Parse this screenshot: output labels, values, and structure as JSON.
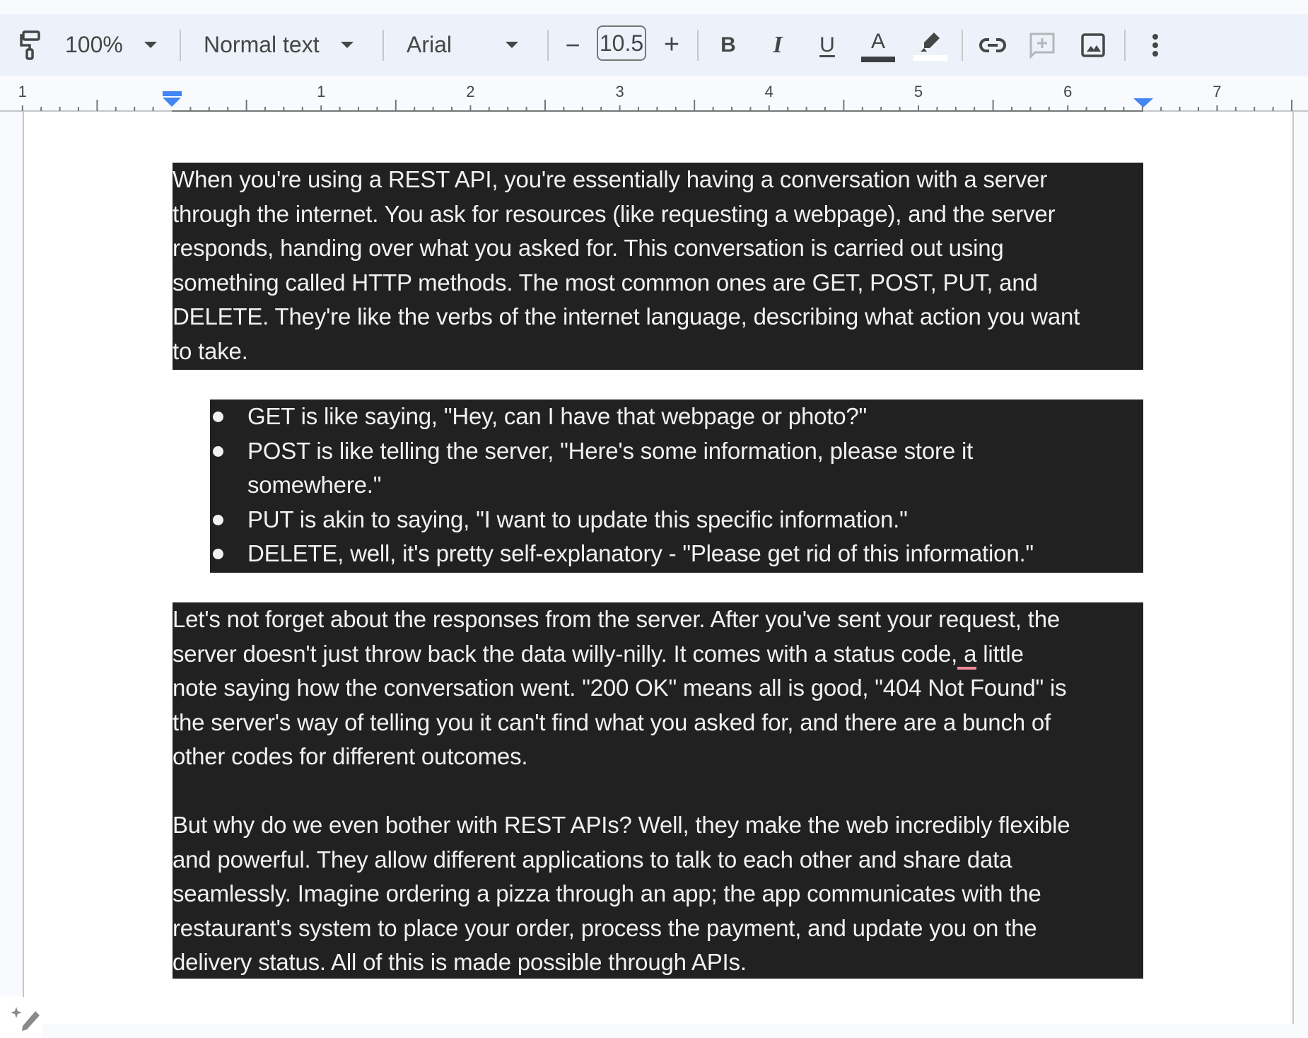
{
  "toolbar": {
    "paint_format_icon": "paint-roller-icon",
    "zoom_value": "100%",
    "style_value": "Normal text",
    "font_value": "Arial",
    "font_size_decrease": "−",
    "font_size_value": "10.5",
    "font_size_increase": "+",
    "bold": "B",
    "italic": "I",
    "underline": "U",
    "text_color": "A",
    "text_color_swatch": "#3c4043",
    "highlight_color_swatch": "#ffffff",
    "link_icon": "link-icon",
    "comment_icon": "add-comment-icon",
    "image_icon": "insert-image-icon",
    "more_icon": "more-vert-icon"
  },
  "ruler": {
    "labels": [
      "1",
      "1",
      "2",
      "3",
      "4",
      "5",
      "6",
      "7"
    ],
    "accent_color": "#4285f4"
  },
  "document": {
    "selection_bg": "#212121",
    "paragraph1": [
      "When you're using a REST API, you're essentially having a conversation with a server",
      "through the internet. You ask for resources (like requesting a webpage), and the server",
      "responds, handing over what you asked for. This conversation is carried out using",
      "something called HTTP methods. The most common ones are GET, POST, PUT, and",
      "DELETE. They're like the verbs of the internet language, describing what action you want",
      "to take."
    ],
    "bullets": [
      {
        "lines": [
          "GET is like saying, \"Hey, can I have that webpage or photo?\""
        ]
      },
      {
        "lines": [
          "POST is like telling the server, \"Here's some information, please store it",
          "somewhere.\""
        ]
      },
      {
        "lines": [
          "PUT is akin to saying, \"I want to update this specific information.\""
        ]
      },
      {
        "lines": [
          "DELETE, well, it's pretty self-explanatory - \"Please get rid of this information.\""
        ]
      }
    ],
    "paragraph2": {
      "line1": "Let's not forget about the responses from the server. After you've sent your request, the",
      "line2_before": "server doesn't just throw back the data willy-nilly. It comes with a status code,",
      "line2_flagged": " a",
      "line2_after": " little",
      "line3": "note saying how the conversation went. \"200 OK\" means all is good, \"404 Not Found\" is",
      "line4": "the server's way of telling you it can't find what you asked for, and there are a bunch of",
      "line5": "other codes for different outcomes."
    },
    "paragraph3": [
      "But why do we even bother with REST APIs? Well, they make the web incredibly flexible",
      "and powerful. They allow different applications to talk to each other and share data",
      "seamlessly. Imagine ordering a pizza through an app; the app communicates with the",
      "restaurant's system to place your order, process the payment, and update you on the",
      "delivery status. All of this is made possible through APIs."
    ]
  },
  "corner_button_icon": "sparkle-pen-icon"
}
